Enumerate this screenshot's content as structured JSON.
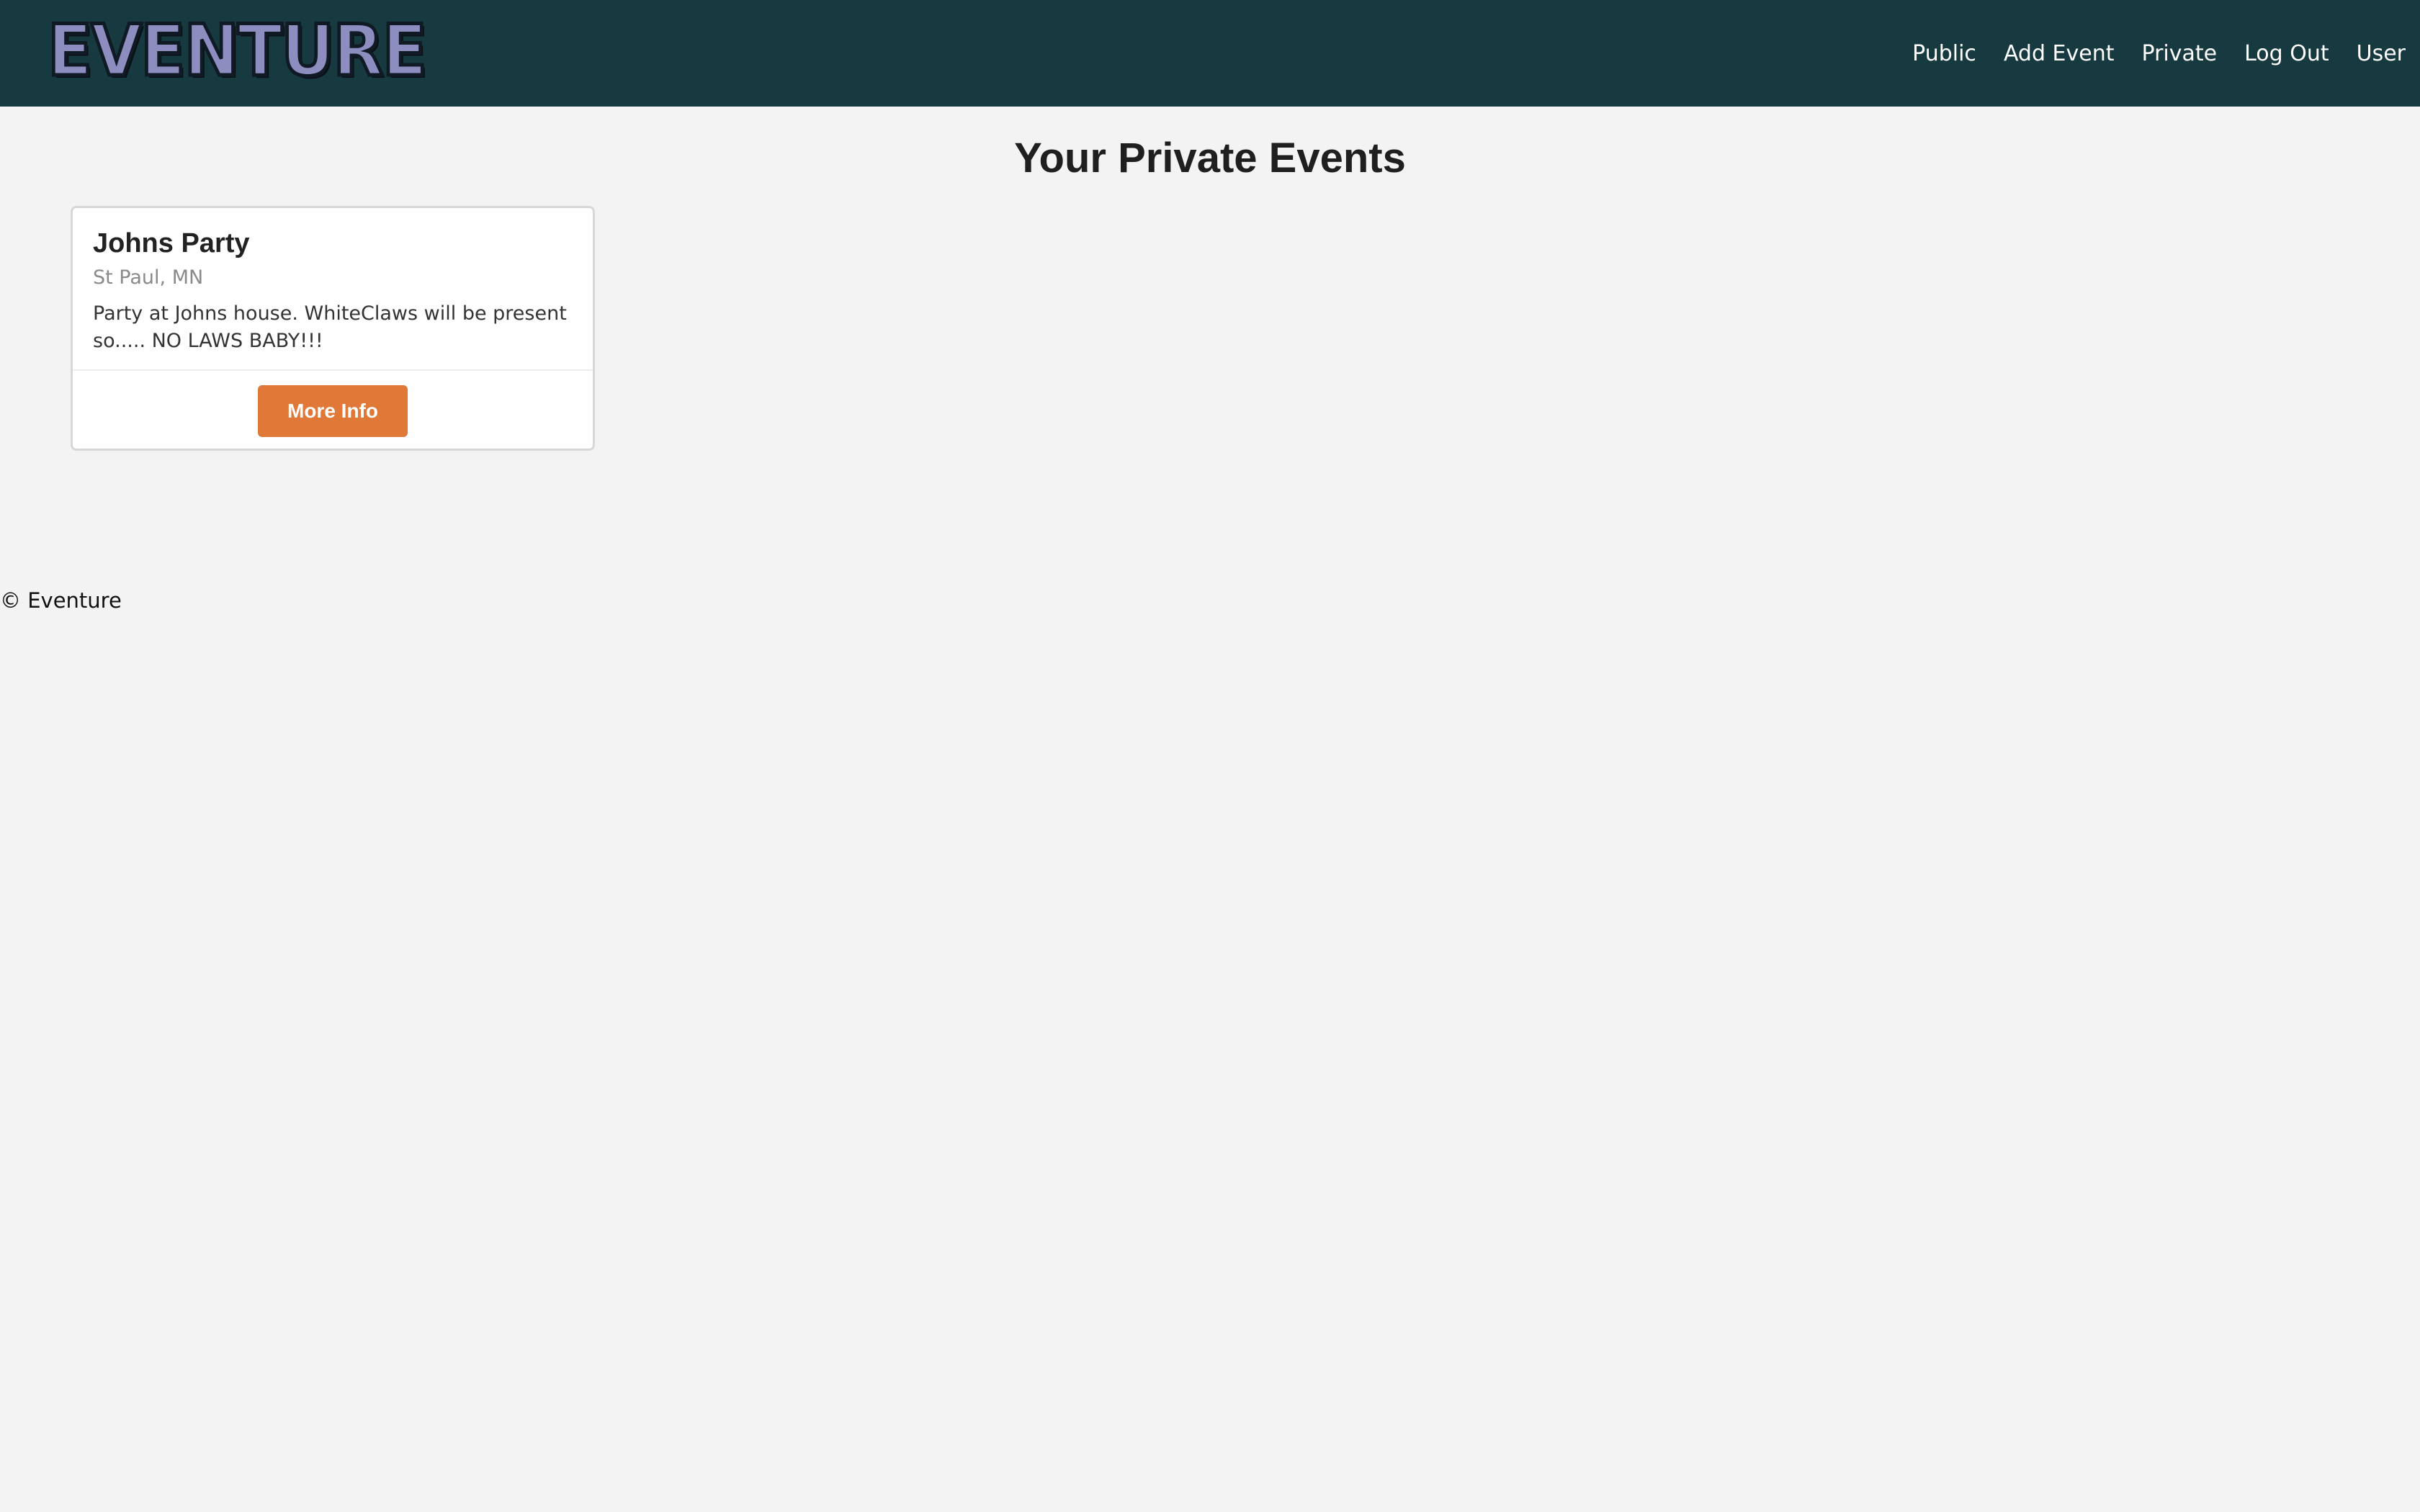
{
  "header": {
    "logo_text": "EVENTURE",
    "nav": [
      {
        "label": "Public"
      },
      {
        "label": "Add Event"
      },
      {
        "label": "Private"
      },
      {
        "label": "Log Out"
      },
      {
        "label": "User"
      }
    ]
  },
  "main": {
    "title": "Your Private Events",
    "events": [
      {
        "title": "Johns Party",
        "location": "St Paul, MN",
        "description": "Party at Johns house. WhiteClaws will be present so..... NO LAWS BABY!!!",
        "button_label": "More Info"
      }
    ]
  },
  "footer": {
    "text": "© Eventure"
  },
  "colors": {
    "navbar": "#163a40",
    "background": "#f2f3f2",
    "button": "#e07838",
    "logo_fill": "#8d8dc0"
  }
}
